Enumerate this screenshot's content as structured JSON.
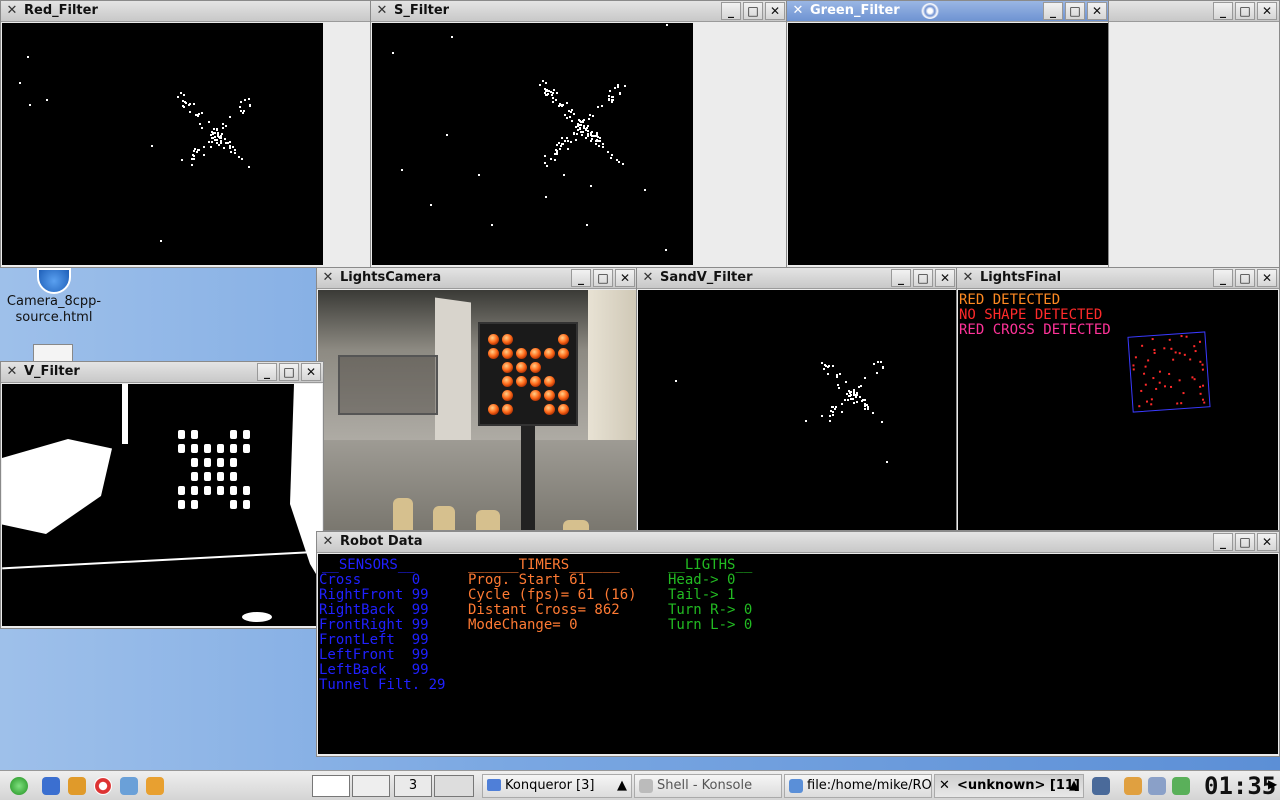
{
  "windows": {
    "red_filter": {
      "title": "Red_Filter"
    },
    "s_filter": {
      "title": "S_Filter"
    },
    "green_filter": {
      "title": "Green_Filter"
    },
    "lights_camera": {
      "title": "LightsCamera"
    },
    "sandv_filter": {
      "title": "SandV_Filter"
    },
    "lights_final": {
      "title": "LightsFinal",
      "detections": [
        "RED DETECTED",
        "NO SHAPE DETECTED",
        "RED CROSS DETECTED"
      ]
    },
    "v_filter": {
      "title": "V_Filter"
    },
    "robot_data": {
      "title": "Robot Data",
      "sensors": {
        "header": "__SENSORS__",
        "lines": [
          "Cross      0",
          "RightFront 99",
          "RightBack  99",
          "FrontRight 99",
          "FrontLeft  99",
          "LeftFront  99",
          "LeftBack   99",
          "Tunnel Filt. 29"
        ]
      },
      "timers": {
        "header": "______TIMERS______",
        "lines": [
          "Prog. Start 61",
          "Cycle (fps)= 61 (16)",
          "Distant Cross= 862",
          "ModeChange= 0"
        ]
      },
      "lights": {
        "header": "__LIGTHS__",
        "lines": [
          "Head-> 0",
          "Tail-> 1",
          "Turn R-> 0",
          "Turn L-> 0"
        ]
      }
    }
  },
  "desktop": {
    "icon_label_1": "Camera_8cpp-",
    "icon_label_2": "source.html"
  },
  "taskbar": {
    "desktop_num": "3",
    "tasks": [
      "Konqueror [3]",
      "Shell - Konsole",
      "file:/home/mike/RO",
      "<unknown> [11]"
    ],
    "clock": "01:35"
  },
  "colors": {
    "sensors": "#2020ff",
    "timers": "#ff7a33",
    "lights": "#22bb22",
    "red_text": "#ff2a2a",
    "orange_text": "#ff8a22",
    "pink_text": "#ff3399"
  }
}
